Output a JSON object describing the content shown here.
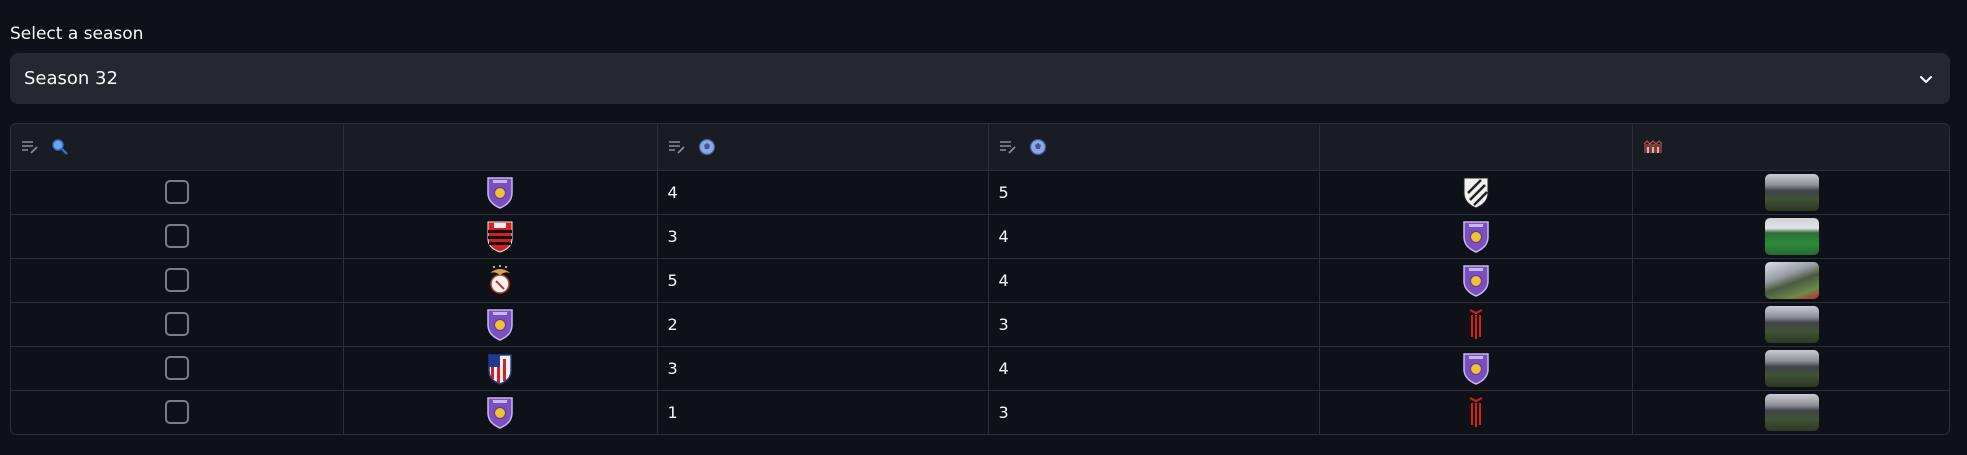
{
  "select": {
    "label": "Select a season",
    "value": "Season 32"
  },
  "table": {
    "header_icons": [
      [
        "edit-list-icon",
        "magnifier-icon"
      ],
      [],
      [
        "edit-list-icon",
        "soccer-ball-icon"
      ],
      [
        "edit-list-icon",
        "soccer-ball-icon"
      ],
      [],
      [
        "stadium-icon"
      ]
    ],
    "rows": [
      {
        "home_crest": "purple-shield-crest",
        "home_goals": "4",
        "away_goals": "5",
        "away_crest": "white-striped-shield-crest",
        "stadium_thumb": "stadium-dark"
      },
      {
        "home_crest": "red-black-stripes-crest",
        "home_goals": "3",
        "away_goals": "4",
        "away_crest": "purple-shield-crest",
        "stadium_thumb": "stadium-green"
      },
      {
        "home_crest": "eagle-crest",
        "home_goals": "5",
        "away_goals": "4",
        "away_crest": "purple-shield-crest",
        "stadium_thumb": "stadium-bright"
      },
      {
        "home_crest": "purple-shield-crest",
        "home_goals": "2",
        "away_goals": "3",
        "away_crest": "red-black-pennant-crest",
        "stadium_thumb": "stadium-dark"
      },
      {
        "home_crest": "red-white-stripes-crest",
        "home_goals": "3",
        "away_goals": "4",
        "away_crest": "purple-shield-crest",
        "stadium_thumb": "stadium-dark"
      },
      {
        "home_crest": "purple-shield-crest",
        "home_goals": "1",
        "away_goals": "3",
        "away_crest": "red-black-pennant-crest",
        "stadium_thumb": "stadium-dark"
      }
    ]
  },
  "colors": {
    "background": "#0e1117",
    "select_bg": "#262730",
    "header_bg": "#1a1c24",
    "border": "#2d2f38",
    "accent_blue": "#4b8ee6",
    "crest_purple": "#7a4fc0"
  }
}
